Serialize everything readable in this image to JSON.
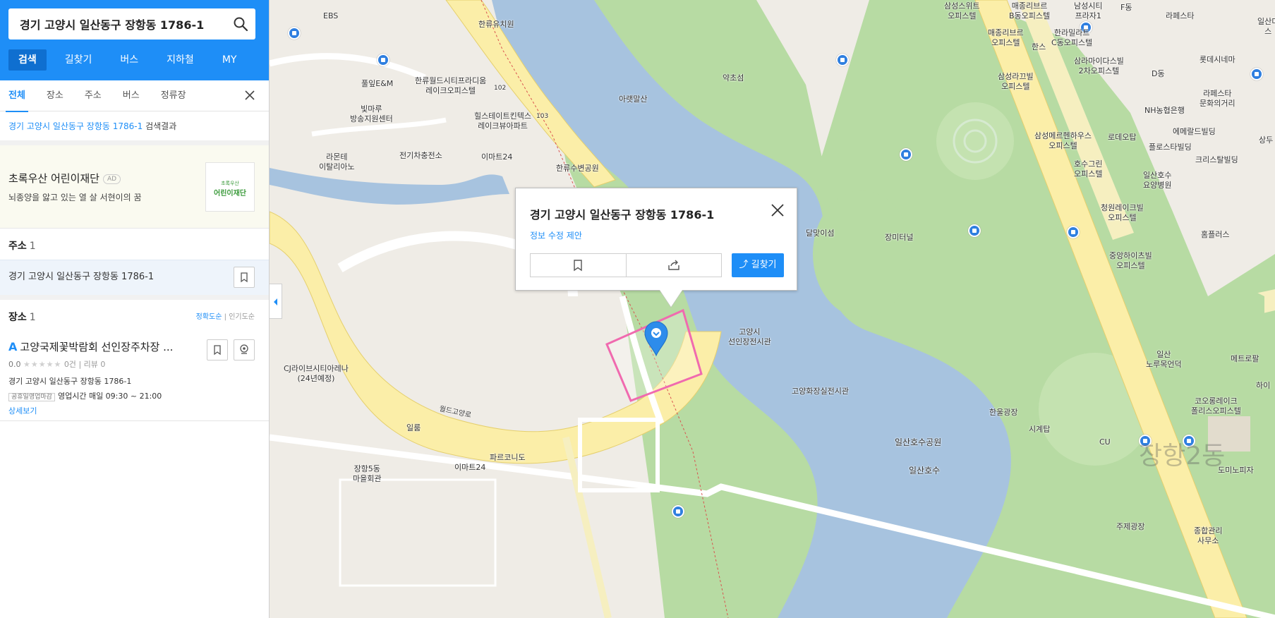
{
  "search": {
    "query": "경기 고양시 일산동구 장항동 1786-1"
  },
  "main_tabs": [
    {
      "label": "검색",
      "active": true
    },
    {
      "label": "길찾기",
      "active": false
    },
    {
      "label": "버스",
      "active": false
    },
    {
      "label": "지하철",
      "active": false
    },
    {
      "label": "MY",
      "active": false
    }
  ],
  "sub_tabs": [
    {
      "label": "전체",
      "active": true
    },
    {
      "label": "장소",
      "active": false
    },
    {
      "label": "주소",
      "active": false
    },
    {
      "label": "버스",
      "active": false
    },
    {
      "label": "정류장",
      "active": false
    }
  ],
  "result_caption": {
    "query": "경기 고양시 일산동구 장항동 1786-1",
    "suffix": "검색결과"
  },
  "ad": {
    "title": "초록우산 어린이재단",
    "badge": "AD",
    "description": "뇌종양을 앓고 있는 열 살 서현이의 꿈",
    "logo_top": "초록우산",
    "logo_main": "어린이재단"
  },
  "address_section": {
    "heading": "주소",
    "count": "1",
    "address": "경기 고양시 일산동구 장항동 1786-1"
  },
  "place_section": {
    "heading": "장소",
    "count": "1",
    "sort_accuracy": "정확도순",
    "sort_popular": "인기도순",
    "item": {
      "marker": "A",
      "name": "고양국제꽃박람회 선인장주차장 ...",
      "score": "0.0",
      "stars": "★★★★★",
      "review_count": "0건",
      "review_label": "리뷰 0",
      "address": "경기 고양시 일산동구 장항동 1786-1",
      "hours_tag": "공휴일영업마감",
      "hours": "영업시간 매일 09:30 ~ 21:00",
      "more": "상세보기"
    }
  },
  "popup": {
    "title": "경기 고양시 일산동구 장항동 1786-1",
    "edit_link": "정보 수정 제안",
    "route_button": "길찾기"
  },
  "map_labels": {
    "ebs": "EBS",
    "hanryu_kinder": "한류유치원",
    "pulip": "풀잎E&M",
    "bitmaru": "빛마루\n방송지원센터",
    "hanryu_world": "한류월드시티프라디움\n레이크오피스텔",
    "hills": "힐스테이트킨텍스\n레이크뷰아파트",
    "n102": "102",
    "n103": "103",
    "lamonte": "라몬테\n이탈리아노",
    "ev": "전기차충전소",
    "emart24_top": "이마트24",
    "hanryu_park": "한류수변공원",
    "akcho": "약초섬",
    "akpyeong": "아랫말산",
    "dalmaji": "달맞이섬",
    "jangmi": "장미터널",
    "cactus": "고양시\n선인장전시관",
    "flower_hall": "고양화장실전시관",
    "cj": "CJ라이브시티아레나\n(24년예정)",
    "worldgoyang": "월드고양로",
    "ilrum": "일룸",
    "parkonido": "파르코니도",
    "emart24_bottom": "이마트24",
    "jangha5": "장항5동\n마을회관",
    "lakepark": "일산호수공원",
    "lake": "일산호수",
    "hanul": "한울광장",
    "clock": "시계탑",
    "cu": "CU",
    "ilsan_norumok": "일산\n노루목언덕",
    "jangang2": "장항2동",
    "metro": "메트로팔",
    "cowoong": "코오롱레이크\n폴리스오피스텔",
    "jujae": "주제광장",
    "jonghap": "종합관리\n사무소",
    "dominoes": "도미노피자",
    "hai": "하이",
    "samsung_suite": "삼성스위트\n오피스텔",
    "maejong": "매종리브르\nB동오피스텔",
    "namsung": "남성시티\n프라자1",
    "fdong": "F동",
    "lafesta": "라페스타",
    "ilsan2": "일산미\n스",
    "maejong2": "매종리브르\n오피스텔",
    "hans": "한스",
    "hanra": "한라밀라트\nC동오피스텔",
    "samla": "삼라마이다스빌\n2차오피스텔",
    "lotte": "롯데시네마",
    "samsung_nara": "삼성라끄빌\n오피스텔",
    "ddong": "D동",
    "lafesta_culture": "라페스타\n문화의거리",
    "nh": "NH농협은행",
    "samsung_meru": "삼성메르헨하우스\n오피스텔",
    "lodeo": "로데오탑",
    "emerald": "에메랄드빌딩",
    "plus": "플로스타빌딩",
    "hosu_green": "호수그린\n오피스텔",
    "ilsan_yoyang": "일산호수\n요양병원",
    "crystal": "크리스탈빌딩",
    "cheongwon": "청원레이크빌\n오피스텔",
    "homeplus": "홈플러스",
    "jungang": "중앙하이츠빌\n오피스텔",
    "sangdu": "상두"
  }
}
